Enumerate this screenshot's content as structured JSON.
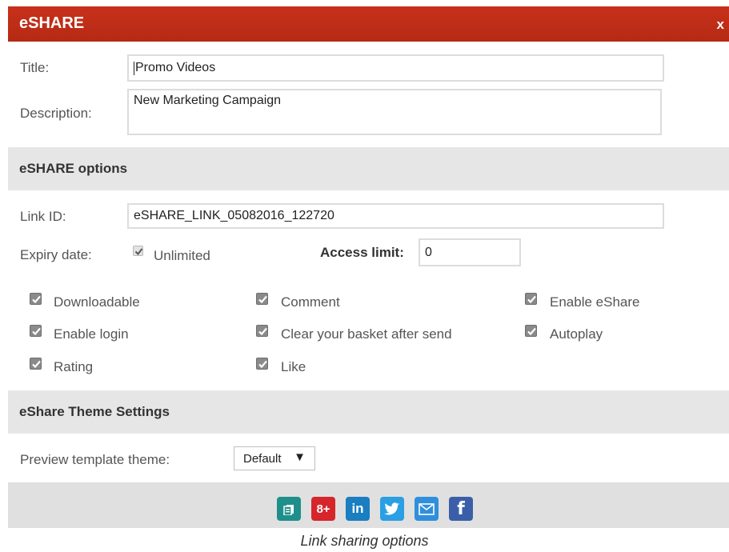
{
  "window": {
    "title": "eSHARE",
    "close_label": "x"
  },
  "form": {
    "title_label": "Title:",
    "title_value": "Promo Videos",
    "description_label": "Description:",
    "description_value": "New Marketing Campaign"
  },
  "options": {
    "heading": "eSHARE options",
    "link_id_label": "Link ID:",
    "link_id_value": "eSHARE_LINK_05082016_122720",
    "expiry_label": "Expiry date:",
    "unlimited_label": "Unlimited",
    "unlimited_checked": true,
    "access_limit_label": "Access limit:",
    "access_limit_value": "0",
    "checkboxes": [
      {
        "label": "Downloadable",
        "checked": true
      },
      {
        "label": "Comment",
        "checked": true
      },
      {
        "label": "Enable eShare",
        "checked": true
      },
      {
        "label": "Enable login",
        "checked": true
      },
      {
        "label": "Clear your basket after send",
        "checked": true
      },
      {
        "label": "Autoplay",
        "checked": true
      },
      {
        "label": "Rating",
        "checked": true
      },
      {
        "label": "Like",
        "checked": true
      }
    ]
  },
  "theme": {
    "heading": "eShare Theme Settings",
    "preview_label": "Preview template theme:",
    "selected": "Default",
    "arrow": "▼"
  },
  "share": {
    "buttons": [
      {
        "name": "copy-icon",
        "color": "#1f8f8b"
      },
      {
        "name": "google-plus-icon",
        "glyph": "8+",
        "color": "#d6252b"
      },
      {
        "name": "linkedin-icon",
        "glyph": "in",
        "color": "#1a7ec0"
      },
      {
        "name": "twitter-icon",
        "color": "#2a9fe3"
      },
      {
        "name": "email-icon",
        "color": "#2f8fdc"
      },
      {
        "name": "facebook-icon",
        "glyph": "f",
        "color": "#3a5fa8"
      }
    ]
  },
  "caption": "Link sharing options"
}
